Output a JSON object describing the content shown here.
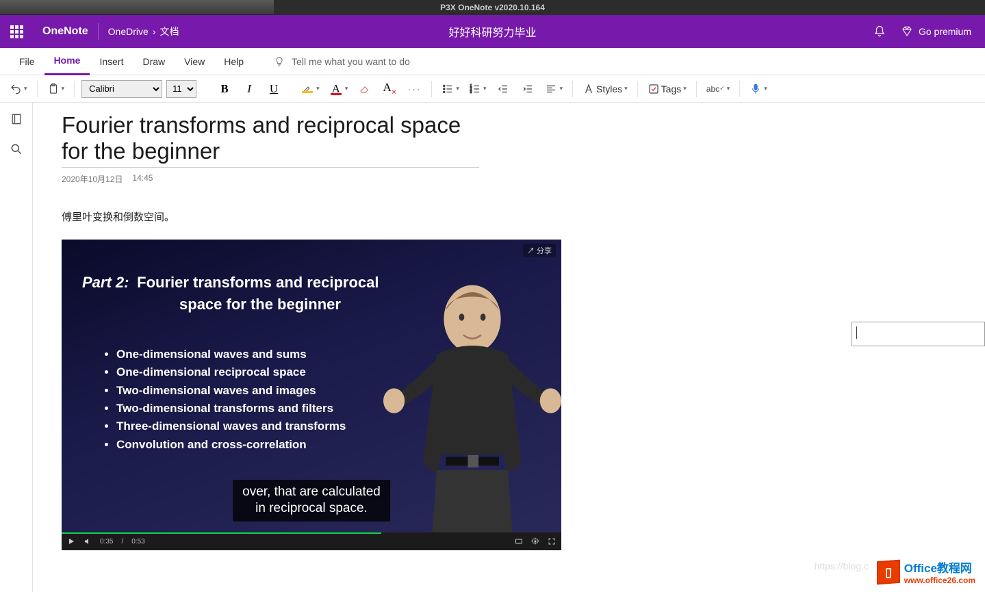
{
  "window": {
    "title": "P3X OneNote v2020.10.164"
  },
  "header": {
    "brand": "OneNote",
    "breadcrumb": {
      "root": "OneDrive",
      "sep": "›",
      "leaf": "文档"
    },
    "notebook_title": "好好科研努力毕业",
    "premium_label": "Go premium"
  },
  "menu": {
    "tabs": [
      "File",
      "Home",
      "Insert",
      "Draw",
      "View",
      "Help"
    ],
    "active_index": 1,
    "tell_me": "Tell me what you want to do"
  },
  "ribbon": {
    "font_name": "Calibri",
    "font_size": "11",
    "styles_label": "Styles",
    "tags_label": "Tags",
    "spellcheck_label": "abc"
  },
  "page": {
    "title": "Fourier transforms and reciprocal space for the beginner",
    "date": "2020年10月12日",
    "time": "14:45",
    "body_line": "傅里叶变换和倒数空间。"
  },
  "video": {
    "share_label": "分享",
    "slide_part": "Part 2:",
    "slide_title_line1": "Fourier transforms and reciprocal",
    "slide_title_line2": "space for the beginner",
    "bullets": [
      "One-dimensional waves and sums",
      "One-dimensional reciprocal space",
      "Two-dimensional waves and images",
      "Two-dimensional transforms and filters",
      "Three-dimensional waves and transforms",
      "Convolution and cross-correlation"
    ],
    "caption_line1": "over, that are calculated",
    "caption_line2": "in reciprocal space.",
    "time_current": "0:35",
    "time_total": "0:53"
  },
  "watermark": {
    "blog": "https://blog.c",
    "logo_main": "Office教程网",
    "logo_sub": "www.office26.com"
  }
}
